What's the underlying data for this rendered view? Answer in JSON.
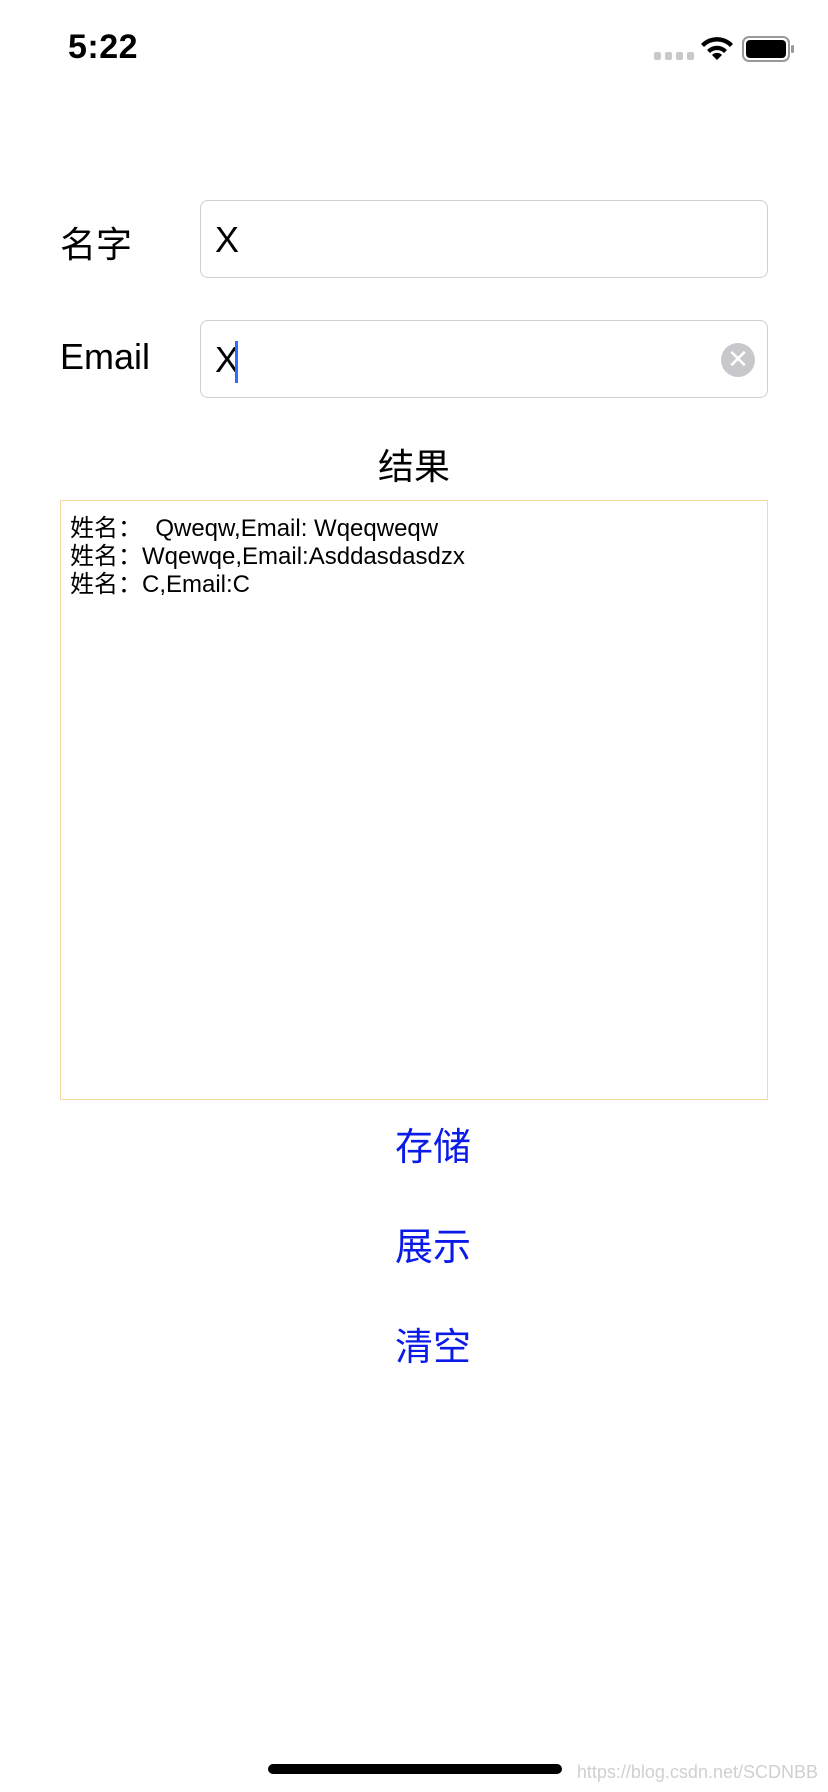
{
  "status_bar": {
    "time": "5:22",
    "signal_icon": "cellular-signal-icon",
    "wifi_icon": "wifi-icon",
    "battery_icon": "battery-icon"
  },
  "form": {
    "name_label": "名字",
    "name_value": "X",
    "email_label": "Email",
    "email_value": "X",
    "clear_icon_glyph": "✕"
  },
  "result": {
    "title": "结果",
    "lines": [
      "姓名：  Qweqw,Email: Wqeqweqw",
      "姓名：Wqewqe,Email:Asddasdasdzx",
      "姓名：C,Email:C"
    ],
    "border_color": "#f5d9a0"
  },
  "actions": {
    "save_label": "存储",
    "show_label": "展示",
    "clear_label": "清空",
    "color": "#0a1be8"
  },
  "watermark": "https://blog.csdn.net/SCDNBB"
}
